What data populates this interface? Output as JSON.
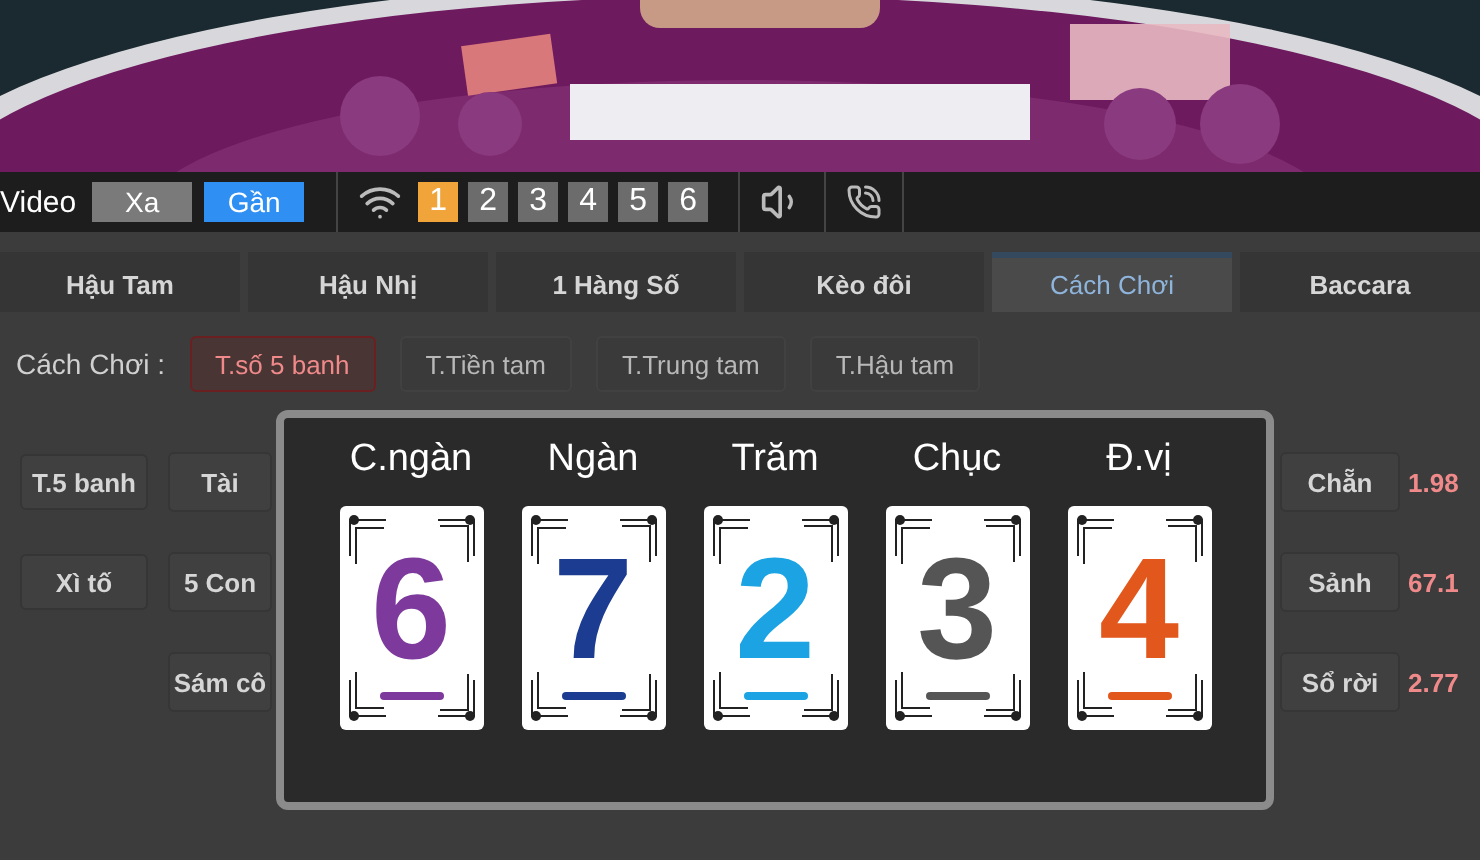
{
  "video_controls": {
    "label": "Video",
    "views": [
      {
        "label": "Xa",
        "selected": false
      },
      {
        "label": "Gần",
        "selected": true
      }
    ],
    "cameras": [
      {
        "label": "1",
        "selected": true
      },
      {
        "label": "2",
        "selected": false
      },
      {
        "label": "3",
        "selected": false
      },
      {
        "label": "4",
        "selected": false
      },
      {
        "label": "5",
        "selected": false
      },
      {
        "label": "6",
        "selected": false
      }
    ]
  },
  "tabs": [
    {
      "label": "Hậu Tam",
      "selected": false
    },
    {
      "label": "Hậu Nhị",
      "selected": false
    },
    {
      "label": "1 Hàng Số",
      "selected": false
    },
    {
      "label": "Kèo đôi",
      "selected": false
    },
    {
      "label": "Cách Chơi",
      "selected": true
    },
    {
      "label": "Baccara",
      "selected": false
    }
  ],
  "play_mode": {
    "label": "Cách Chơi :",
    "options": [
      {
        "label": "T.số 5 banh",
        "selected": true
      },
      {
        "label": "T.Tiền tam",
        "selected": false
      },
      {
        "label": "T.Trung tam",
        "selected": false
      },
      {
        "label": "T.Hậu tam",
        "selected": false
      }
    ]
  },
  "bet_rows": [
    {
      "category": "T.5 banh",
      "left": "Tài",
      "right": "Chẵn",
      "odds": "1.98"
    },
    {
      "category": "Xì tố",
      "left": "5 Con",
      "right": "Sảnh",
      "odds": "67.1"
    },
    {
      "left": "Sám cô",
      "right": "Sổ rời",
      "odds": "2.77"
    }
  ],
  "result": {
    "columns": [
      {
        "label": "C.ngàn",
        "digit": "6",
        "color": "#7d3a9c"
      },
      {
        "label": "Ngàn",
        "digit": "7",
        "color": "#1c3c92"
      },
      {
        "label": "Trăm",
        "digit": "2",
        "color": "#1ba3e3"
      },
      {
        "label": "Chục",
        "digit": "3",
        "color": "#555555"
      },
      {
        "label": "Đ.vị",
        "digit": "4",
        "color": "#e2581c"
      }
    ]
  }
}
